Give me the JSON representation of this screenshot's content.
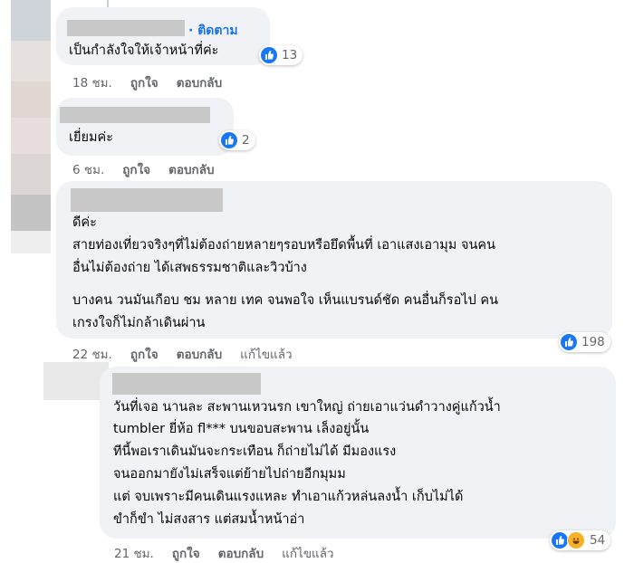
{
  "comments": [
    {
      "follow_label": "· ติดตาม",
      "lines": [
        "เป็นกำลังใจให้เจ้าหน้าที่ค่ะ"
      ],
      "time": "18 ชม.",
      "like_label": "ถูกใจ",
      "reply_label": "ตอบกลับ",
      "reaction_count": "13"
    },
    {
      "lines": [
        "เยี่ยมค่ะ"
      ],
      "time": "6 ชม.",
      "like_label": "ถูกใจ",
      "reply_label": "ตอบกลับ",
      "reaction_count": "2"
    },
    {
      "lines": [
        "ดีค่ะ",
        "สายท่องเที่ยวจริงๆที่ไม่ต้องถ่ายหลายๆรอบหรือยึดพื้นที่ เอาแสงเอามุม จนคน",
        "อื่นไม่ต้องถ่าย ได้เสพธรรมชาติและวิวบ้าง",
        "บางคน วนมันเกือบ ชม หลาย เทค จนพอใจ เห็นแบรนด์ชัด คนอื่นก็รอไป คน",
        "เกรงใจก็ไม่กล้าเดินผ่าน"
      ],
      "time": "22 ชม.",
      "like_label": "ถูกใจ",
      "reply_label": "ตอบกลับ",
      "edited_label": "แก้ไขแล้ว",
      "reaction_count": "198"
    },
    {
      "lines": [
        "วันที่เจอ นานละ สะพานเหวนรก เขาใหญ่ ถ่ายเอาแว่นดำวางคู่แก้วน้ำ",
        "tumbler ยี่ห้อ fl*** บนขอบสะพาน เล็งอยู่นั้น",
        "ทีนี้พอเราเดินมันจะกระเทือน ก็ถ่ายไม่ได้ มีมองแรง",
        "จนออกมายังไม่เสร็จแต่ย้ายไปถ่ายอีกมุมม",
        "แต่ จบเพราะมีคนเดินแรงแหละ ทำเอาแก้วหล่นลงน้ำ เก็บไม่ได้",
        "ขำก็ขำ ไม่สงสาร แต่สมน้ำหน้าอ่า"
      ],
      "time": "21 ชม.",
      "like_label": "ถูกใจ",
      "reply_label": "ตอบกลับ",
      "edited_label": "แก้ไขแล้ว",
      "reaction_count": "54"
    }
  ],
  "icons": {
    "like": "like-icon",
    "haha": "haha-icon"
  },
  "colors": {
    "bubble": "#f0f2f5",
    "link": "#1b74e4",
    "like": "#1877f2",
    "meta": "#65676b"
  }
}
